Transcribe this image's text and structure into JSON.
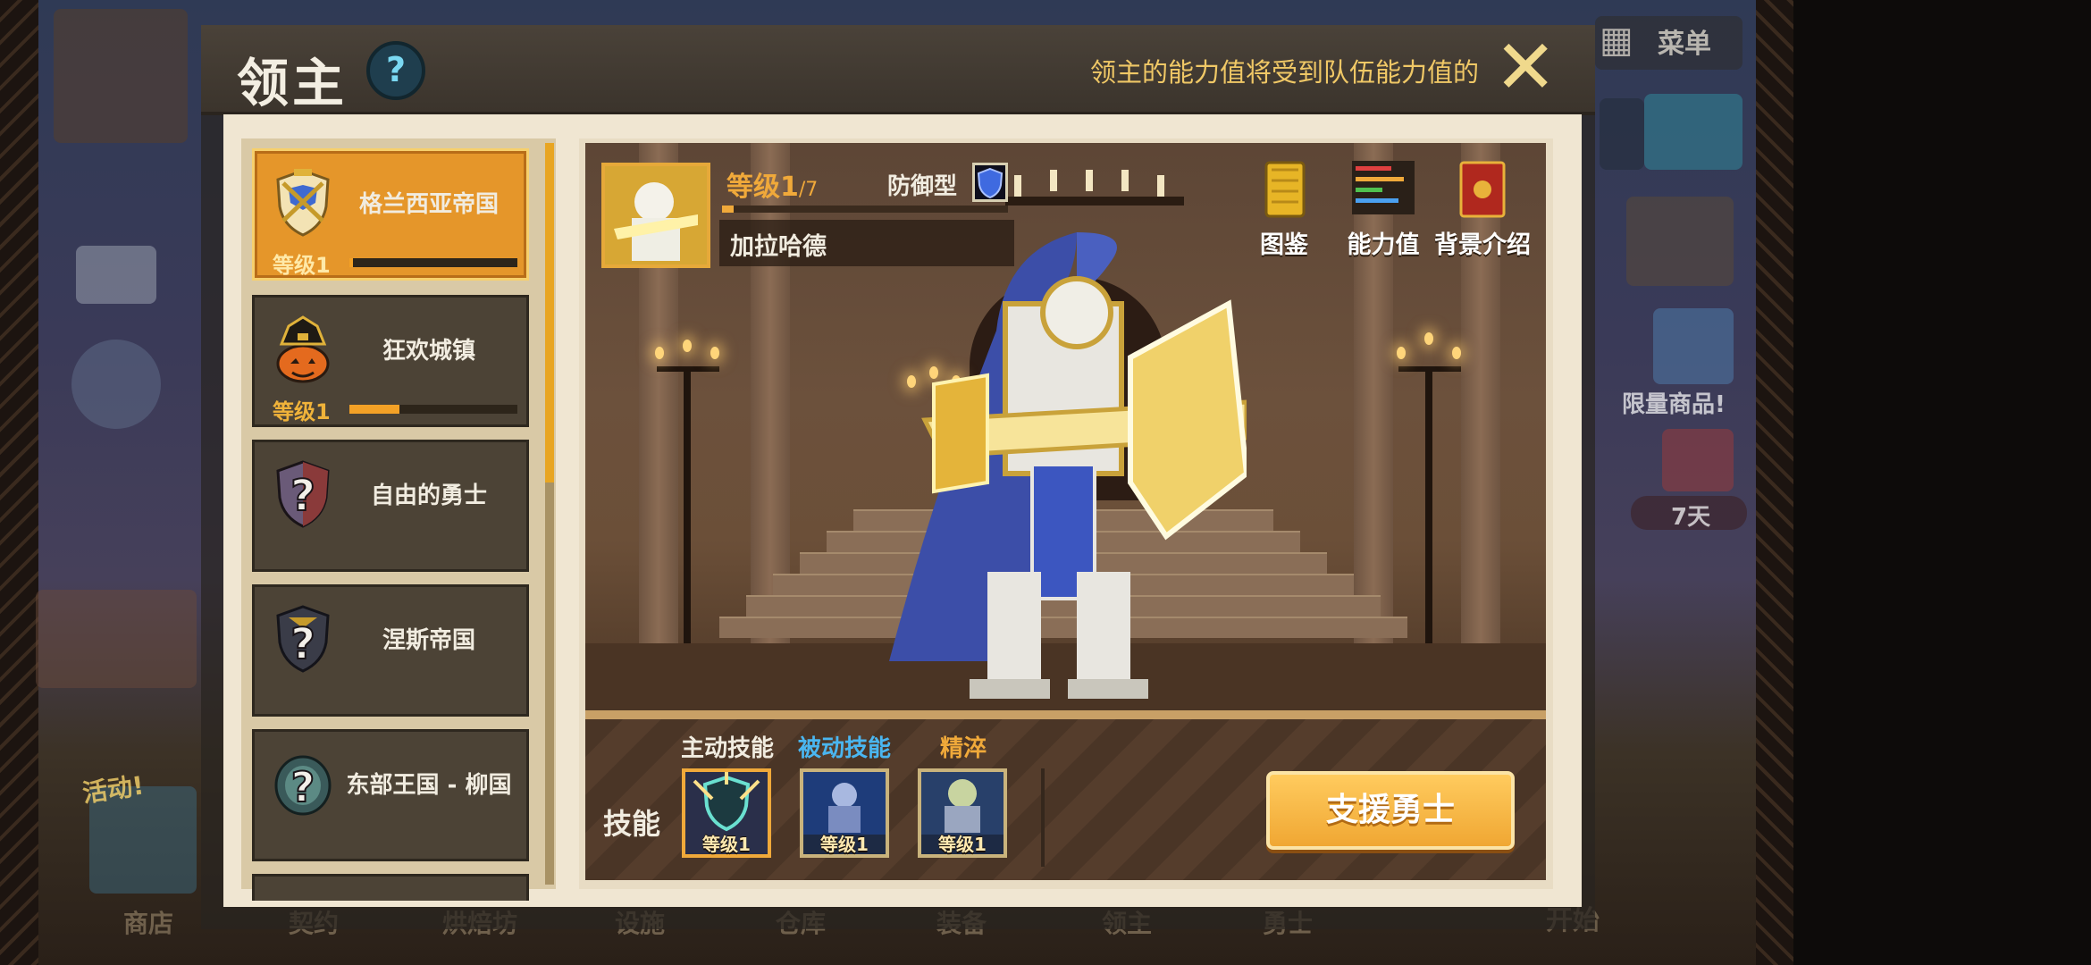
{
  "header": {
    "title": "领主",
    "help": "?",
    "notice": "领主的能力值将受到队伍能力值的",
    "close": "✕"
  },
  "background": {
    "menu_label": "菜单",
    "limited_offer": "限量商品!",
    "days_left": "7天",
    "event_label": "活动!",
    "start_label": "开始",
    "nav": [
      "商店",
      "契约",
      "烘焙坊",
      "设施",
      "仓库",
      "装备",
      "领主",
      "勇士"
    ]
  },
  "lords": [
    {
      "name": "格兰西亚帝国",
      "level": "等级1",
      "progress": 0.02,
      "selected": true,
      "icon": "crest-icon"
    },
    {
      "name": "狂欢城镇",
      "level": "等级1",
      "progress": 0.3,
      "selected": false,
      "icon": "pumpkin-icon"
    },
    {
      "name": "自由的勇士",
      "level": "",
      "progress": null,
      "selected": false,
      "icon": "unknown-lord-icon"
    },
    {
      "name": "涅斯帝国",
      "level": "",
      "progress": null,
      "selected": false,
      "icon": "unknown-lord-icon"
    },
    {
      "name": "东部王国 - 柳国",
      "level": "",
      "progress": null,
      "selected": false,
      "icon": "unknown-lord-icon"
    }
  ],
  "detail": {
    "level_text": "等级1",
    "level_max": "/7",
    "type": "防御型",
    "lord_name": "加拉哈德",
    "exp_progress": 0.04,
    "buttons": {
      "codex": "图鉴",
      "stats": "能力值",
      "background": "背景介绍"
    }
  },
  "skills": {
    "label": "技能",
    "tab_active": "主动技能",
    "tab_passive": "被动技能",
    "tab_refine": "精淬",
    "slots": [
      "等级1",
      "等级1",
      "等级1"
    ],
    "support_button": "支援勇士"
  },
  "colors": {
    "accent_orange": "#e5962a",
    "gold_text": "#f0a93a",
    "passive_tab": "#4ab6f0",
    "refine_tab": "#f0a93a"
  }
}
